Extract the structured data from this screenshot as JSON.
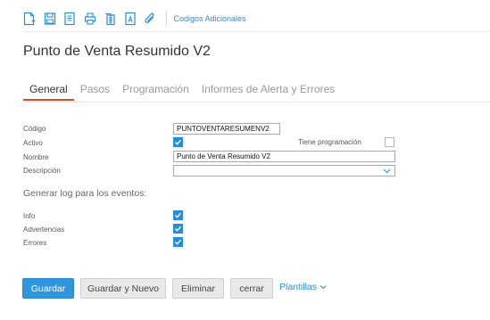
{
  "toolbar": {
    "icons": [
      "new-document-icon",
      "save-icon",
      "document-list-icon",
      "print-icon",
      "documents-icon",
      "text-document-icon",
      "attachment-icon"
    ],
    "link_label": "Codigos Adicionales"
  },
  "page": {
    "title": "Punto de Venta Resumido V2"
  },
  "tabs": [
    {
      "label": "General",
      "active": true
    },
    {
      "label": "Pasos",
      "active": false
    },
    {
      "label": "Programación",
      "active": false
    },
    {
      "label": "Informes de Alerta y Errores",
      "active": false
    }
  ],
  "form": {
    "codigo": {
      "label": "Código",
      "value": "PUNTOVENTARESUMENV2"
    },
    "activo": {
      "label": "Activo",
      "checked": true
    },
    "tiene_programacion": {
      "label": "Tiene programación",
      "checked": false
    },
    "nombre": {
      "label": "Nombre",
      "value": "Punto de Venta Resumido V2"
    },
    "descripcion": {
      "label": "Descripción",
      "value": ""
    }
  },
  "log_section": {
    "title": "Generar log para los eventos:",
    "items": [
      {
        "label": "Info",
        "checked": true
      },
      {
        "label": "Advertencias",
        "checked": true
      },
      {
        "label": "Errores",
        "checked": true
      }
    ]
  },
  "buttons": {
    "save": "Guardar",
    "save_new": "Guardar y Nuevo",
    "delete": "Eliminar",
    "close": "cerrar",
    "templates": "Plantillas"
  },
  "colors": {
    "accent": "#2a8dd4",
    "active_tab_underline": "#d94c2b",
    "primary_button": "#2f95dc"
  }
}
